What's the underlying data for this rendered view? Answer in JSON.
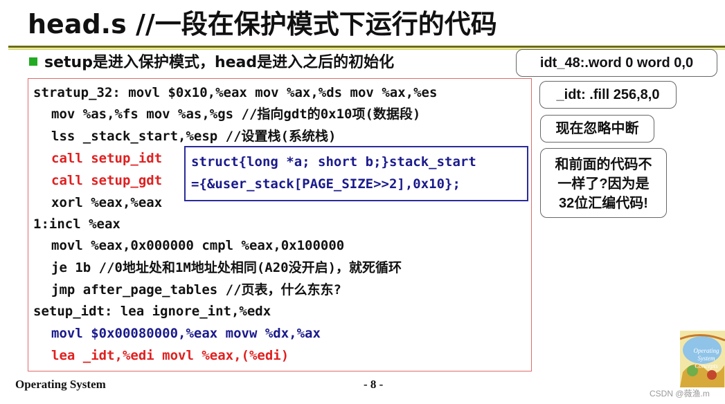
{
  "title": "head.s //一段在保护模式下运行的代码",
  "bullet": "setup是进入保护模式，head是进入之后的初始化",
  "colors": {
    "bullet": "#22aa22",
    "code_border": "#e06a6a",
    "struct_border": "#2a2a99",
    "red_code": "#e02020",
    "blue_code": "#1a1a8c"
  },
  "code": {
    "line1": "stratup_32: movl $0x10,%eax  mov %ax,%ds  mov %ax,%es",
    "line2": "mov %as,%fs  mov %as,%gs  //指向gdt的0x10项(数据段)",
    "line3": "lss _stack_start,%esp  //设置栈(系统栈)",
    "line4": "call setup_idt",
    "line5": "call setup_gdt",
    "line6": "xorl %eax,%eax",
    "line7": "1:incl %eax",
    "line8": "movl %eax,0x000000 cmpl %eax,0x100000",
    "line9": "je 1b    //0地址处和1M地址处相同(A20没开启)，就死循环",
    "line10": "jmp after_page_tables  //页表，什么东东?",
    "line11": "setup_idt: lea ignore_int,%edx",
    "line12": "movl $0x00080000,%eax  movw %dx,%ax",
    "line13": "lea _idt,%edi  movl %eax,(%edi)"
  },
  "struct": {
    "line1": "struct{long *a; short b;}stack_start",
    "line2": "={&user_stack[PAGE_SIZE>>2],0x10};"
  },
  "notes": {
    "idt48": "idt_48:.word 0  word 0,0",
    "idt": "_idt: .fill 256,8,0",
    "ignore": "现在忽略中断",
    "diff1": "和前面的代码不",
    "diff2": "一样了?因为是",
    "diff3": "32位汇编代码!"
  },
  "footer": {
    "left": "Operating System",
    "page": "- 8 -",
    "watermark": "CSDN @薇渔.m"
  },
  "book_text": "Operating System Concepts"
}
